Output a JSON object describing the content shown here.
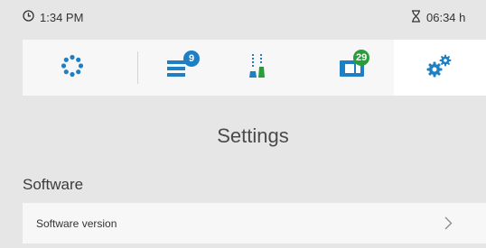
{
  "status_bar": {
    "time": "1:34 PM",
    "timer": "06:34 h",
    "clock_icon": "clock-icon",
    "timer_icon": "hourglass-icon"
  },
  "tabs": [
    {
      "icon": "dots-ring-icon",
      "active": false
    },
    {
      "icon": "list-icon",
      "badge": "9",
      "badge_color": "#1f7fc4",
      "active": false
    },
    {
      "icon": "dispenser-icon",
      "active": false
    },
    {
      "icon": "inventory-icon",
      "badge": "29",
      "badge_color": "#2a9d3a",
      "active": false
    },
    {
      "icon": "gears-icon",
      "active": true
    }
  ],
  "accent_color": "#1f7fc4",
  "page": {
    "title": "Settings",
    "section": "Software",
    "items": [
      {
        "label": "Software version"
      }
    ]
  }
}
